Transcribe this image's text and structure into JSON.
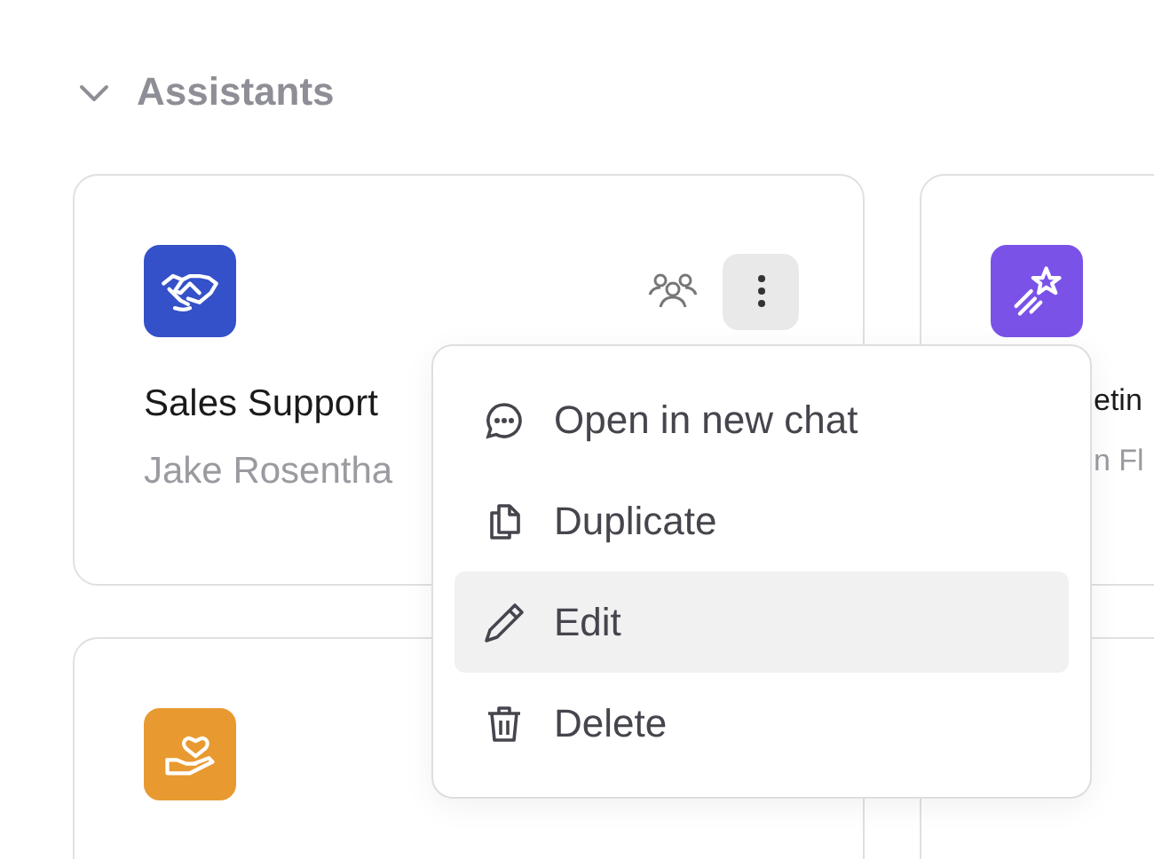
{
  "section": {
    "title": "Assistants",
    "expanded": true
  },
  "cards": [
    {
      "kind": "owned",
      "color": "#3551c9",
      "title": "Sales Support",
      "author": "Jake Rosentha"
    },
    {
      "kind": "clipped",
      "color": "#7a52e8",
      "title": "etin",
      "author": "n Fl"
    },
    {
      "kind": "plain",
      "color": "#e89a30"
    },
    {
      "kind": "empty"
    }
  ],
  "menu": [
    {
      "label": "Open in new chat",
      "highlighted": false
    },
    {
      "label": "Duplicate",
      "highlighted": false
    },
    {
      "label": "Edit",
      "highlighted": true
    },
    {
      "label": "Delete",
      "highlighted": false
    }
  ]
}
